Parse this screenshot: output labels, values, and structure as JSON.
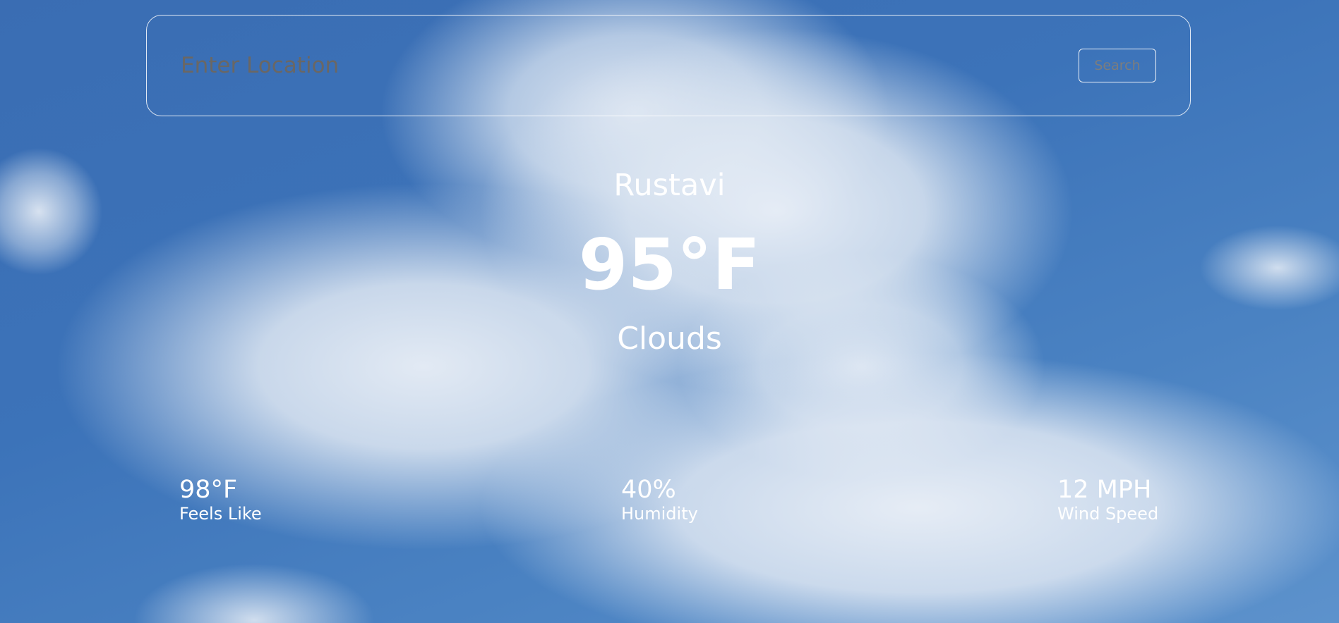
{
  "search": {
    "placeholder": "Enter Location",
    "button_label": "Search"
  },
  "weather": {
    "city": "Rustavi",
    "temperature": "95°F",
    "condition": "Clouds"
  },
  "stats": {
    "feels_like": {
      "value": "98°F",
      "label": "Feels Like"
    },
    "humidity": {
      "value": "40%",
      "label": "Humidity"
    },
    "wind_speed": {
      "value": "12 MPH",
      "label": "Wind Speed"
    }
  }
}
